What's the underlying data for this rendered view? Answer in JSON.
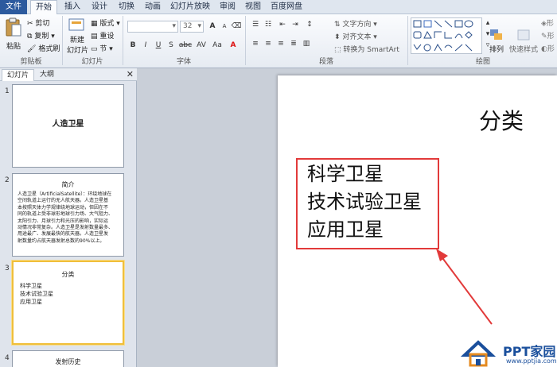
{
  "ribbon": {
    "tabs": [
      "文件",
      "开始",
      "插入",
      "设计",
      "切换",
      "动画",
      "幻灯片放映",
      "审阅",
      "视图",
      "百度网盘"
    ],
    "active_tab": "开始",
    "clipboard": {
      "paste": "粘贴",
      "cut": "剪切",
      "copy": "复制",
      "format_painter": "格式刷",
      "group": "剪贴板"
    },
    "slides": {
      "new_slide_line1": "新建",
      "new_slide_line2": "幻灯片",
      "layout": "版式",
      "reset": "重设",
      "section": "节",
      "group": "幻灯片"
    },
    "font": {
      "size": "32",
      "group": "字体",
      "bold": "B",
      "italic": "I",
      "underline": "U",
      "strike": "S",
      "abc": "abc",
      "spacing": "AV",
      "case": "Aa",
      "color": "A",
      "grow": "A",
      "shrink": "A"
    },
    "paragraph": {
      "text_direction": "文字方向",
      "align_text": "对齐文本",
      "smartart": "转换为 SmartArt",
      "group": "段落"
    },
    "drawing": {
      "arrange": "排列",
      "quick_styles": "快速样式",
      "shape_fill": "形",
      "shape_outline": "形",
      "shape_effects": "形",
      "group": "绘图"
    }
  },
  "left_panel": {
    "tabs": [
      "幻灯片",
      "大纲"
    ],
    "active_tab": "幻灯片",
    "close": "✕",
    "thumbnails": [
      {
        "number": "1",
        "title": "人造卫星",
        "body": []
      },
      {
        "number": "2",
        "title": "简介",
        "body": [
          "人造卫星（ArtificialSatellite）：环绕地球在",
          "空间轨道上运行的无人航天器。人造卫星基",
          "本按照天体力学规律绕地球运动，但因在不",
          "同的轨道上受非球形地球引力场、大气阻力、",
          "太阳引力、月球引力和光压的影响，实际运",
          "动情况非常复杂。人造卫星是发射数量最多、",
          "用途最广、发展最快的航天器。人造卫星发",
          "射数量约占航天器发射总数的90%以上。"
        ]
      },
      {
        "number": "3",
        "title": "分类",
        "body": [
          "科学卫星",
          "技术试验卫星",
          "应用卫星"
        ]
      },
      {
        "number": "4",
        "title": "发射历史",
        "body": []
      }
    ]
  },
  "slide": {
    "title": "分类",
    "items": [
      "科学卫星",
      "技术试验卫星",
      "应用卫星"
    ],
    "highlight_color": "#e23a3a"
  },
  "watermark": {
    "name": "PPT家园",
    "url": "www.pptjia.com"
  }
}
